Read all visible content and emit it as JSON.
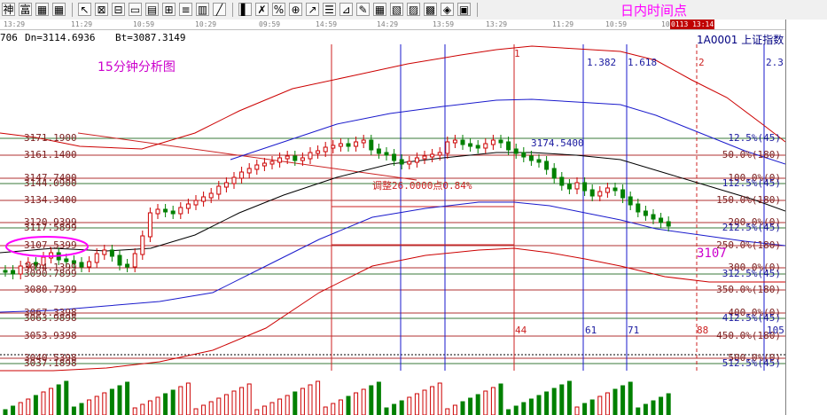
{
  "toolbar": {
    "title": "日内时间点",
    "groups": [
      {
        "icons": [
          {
            "glyph": "神",
            "name": "hist-button"
          },
          {
            "glyph": "富",
            "name": "rich-button"
          },
          {
            "glyph": "▦",
            "name": "grid-view-button"
          },
          {
            "glyph": "▦",
            "name": "table-view-button"
          }
        ]
      },
      {
        "icons": [
          {
            "glyph": "↖",
            "name": "pointer-tool-icon"
          },
          {
            "glyph": "⊠",
            "name": "cross-tool-icon"
          },
          {
            "glyph": "⊟",
            "name": "box-tool-icon"
          },
          {
            "glyph": "▭",
            "name": "rect-tool-icon"
          },
          {
            "glyph": "▤",
            "name": "bars-tool-icon"
          },
          {
            "glyph": "⊞",
            "name": "grid-tool-icon"
          },
          {
            "glyph": "≡",
            "name": "lines-tool-icon"
          },
          {
            "glyph": "▥",
            "name": "columns-tool-icon"
          },
          {
            "glyph": "╱",
            "name": "trend-tool-icon"
          }
        ]
      },
      {
        "icons": [
          {
            "glyph": "▌",
            "name": "candle-tool-icon"
          },
          {
            "glyph": "✗",
            "name": "delete-tool-icon"
          },
          {
            "glyph": "%",
            "name": "percent-tool-icon"
          },
          {
            "glyph": "⊕",
            "name": "add-tool-icon"
          },
          {
            "glyph": "↗",
            "name": "arrow-tool-icon"
          },
          {
            "glyph": "☰",
            "name": "list-tool-icon"
          },
          {
            "glyph": "⊿",
            "name": "triangle-tool-icon"
          },
          {
            "glyph": "✎",
            "name": "pen-tool-icon"
          },
          {
            "glyph": "▦",
            "name": "fib-tool-icon"
          },
          {
            "glyph": "▧",
            "name": "fan-tool-icon"
          },
          {
            "glyph": "▨",
            "name": "gann-tool-icon"
          },
          {
            "glyph": "▩",
            "name": "cycle-tool-icon"
          },
          {
            "glyph": "◈",
            "name": "channel-tool-icon"
          },
          {
            "glyph": "▣",
            "name": "frame-tool-icon"
          }
        ]
      }
    ]
  },
  "time_axis": {
    "labels": [
      "13:29",
      "11:29",
      "10:59",
      "10:29",
      "09:59",
      "14:59",
      "14:29",
      "13:59",
      "13:29",
      "11:29",
      "10:59",
      "10:59"
    ],
    "highlight": "0113 13:14"
  },
  "header": {
    "left_fragment": "706",
    "dn": "Dn=3114.6936",
    "bt": "Bt=3087.3149",
    "index_code": "1A0001",
    "index_name": "上证指数"
  },
  "subtitle": "15分钟分析图",
  "left_levels": [
    "3171.1900",
    "3161.1400",
    "3147.7400",
    "3144.0900",
    "3134.3400",
    "3120.9399",
    "3117.5899",
    "3107.5399",
    "3094.1399",
    "3090.7899",
    "3080.7399",
    "3067.3398",
    "3063.9898",
    "3053.9398",
    "3040.5398",
    "3037.1898"
  ],
  "right_levels": [
    {
      "text": "12.5%(45)",
      "color": "blue"
    },
    {
      "text": "50.0%(180)",
      "color": "red"
    },
    {
      "text": "100.0%(0)",
      "color": "red"
    },
    {
      "text": "112.5%(45)",
      "color": "blue"
    },
    {
      "text": "150.0%(180)",
      "color": "red"
    },
    {
      "text": "200.0%(0)",
      "color": "red"
    },
    {
      "text": "212.5%(45)",
      "color": "blue"
    },
    {
      "text": "250.0%(180)",
      "color": "red"
    },
    {
      "text": "300.0%(0)",
      "color": "red"
    },
    {
      "text": "312.5%(45)",
      "color": "blue"
    },
    {
      "text": "350.0%(180)",
      "color": "red"
    },
    {
      "text": "400.0%(0)",
      "color": "red"
    },
    {
      "text": "412.5%(45)",
      "color": "blue"
    },
    {
      "text": "450.0%(180)",
      "color": "red"
    },
    {
      "text": "500.0%(0)",
      "color": "red"
    },
    {
      "text": "512.5%(45)",
      "color": "blue"
    }
  ],
  "annotations": {
    "adjust": "调整26.0000点0.84%",
    "high_price": "3174.5400",
    "current": "3107",
    "fib_a": "1.382",
    "fib_b": "1.618",
    "cycle_1": "1",
    "cycle_2": "2",
    "cycle_3": "2.3",
    "count_a": "44",
    "count_b": "61",
    "count_c": "71",
    "count_d": "88",
    "count_e": "105"
  },
  "colors": {
    "fib_line": "#b03030",
    "ma_blue": "#1a1acc",
    "ma_black": "#000000",
    "band_red": "#cc0000",
    "up_candle": "#cc0000",
    "down_candle": "#008000",
    "ellipse": "#ff00ff",
    "title": "#ff00ff"
  }
}
